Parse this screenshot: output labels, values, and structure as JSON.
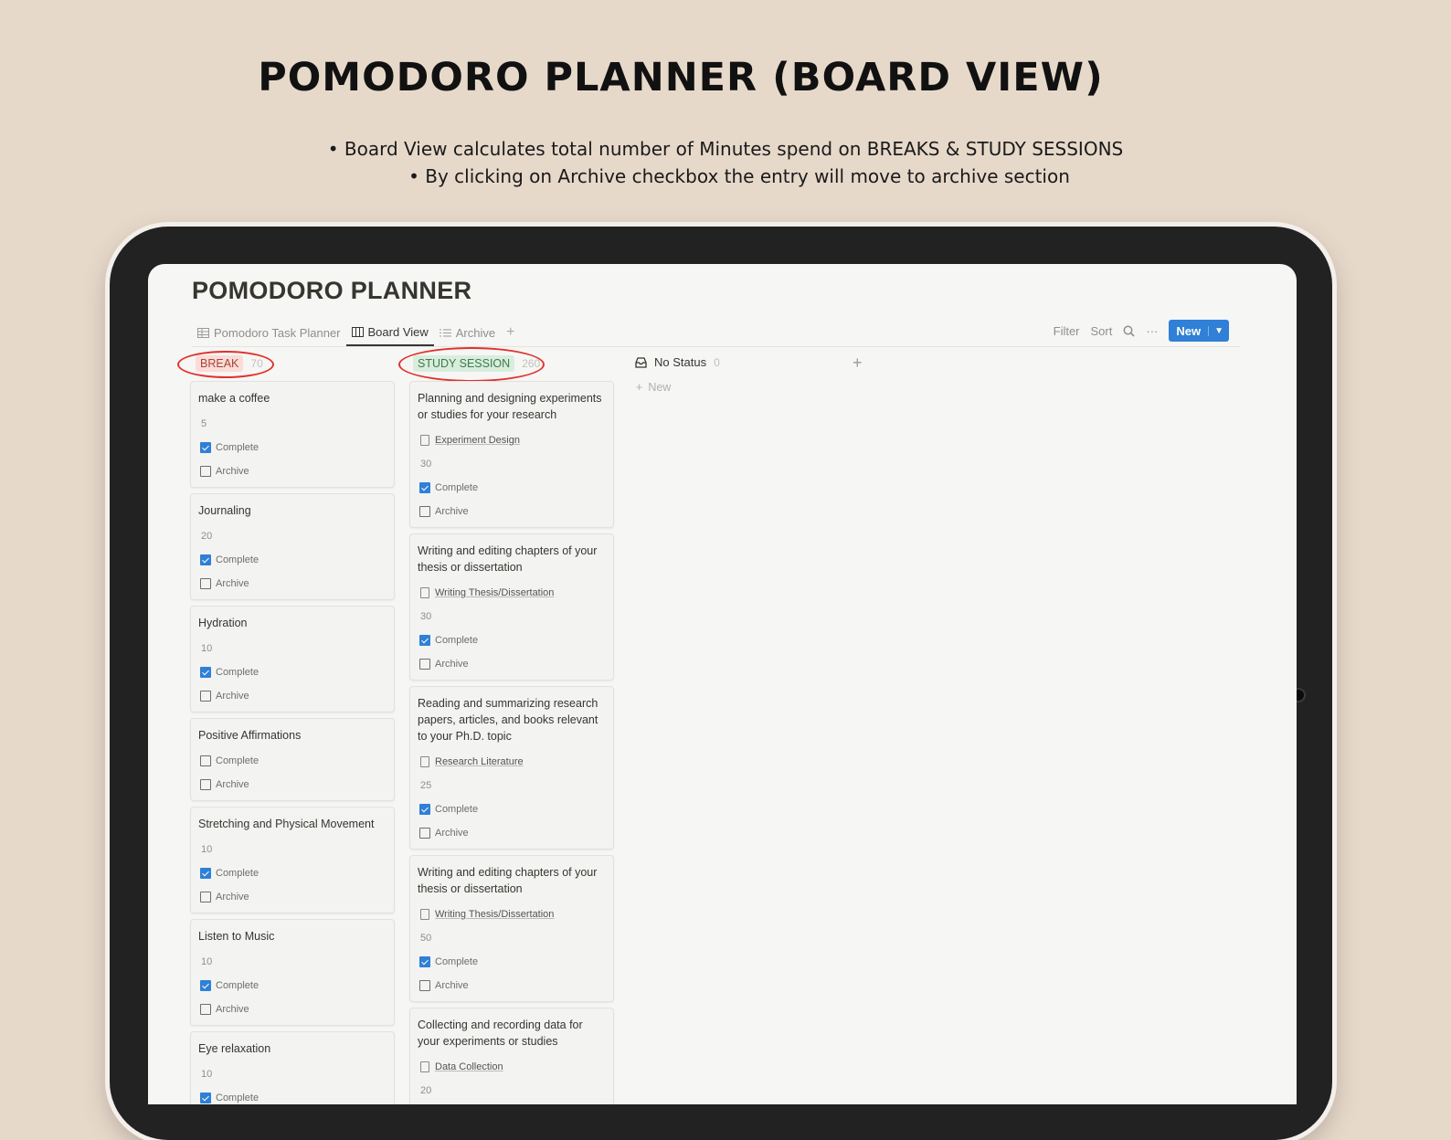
{
  "headline": "POMODORO PLANNER (BOARD VIEW)",
  "bullets": [
    "Board View calculates total number of Minutes spend on BREAKS & STUDY SESSIONS",
    "By clicking on Archive checkbox the entry will move to archive section"
  ],
  "app": {
    "page_title": "POMODORO PLANNER",
    "tabs": [
      {
        "label": "Pomodoro Task Planner",
        "icon": "table-icon",
        "active": false
      },
      {
        "label": "Board View",
        "icon": "board-icon",
        "active": true
      },
      {
        "label": "Archive",
        "icon": "list-icon",
        "active": false
      }
    ],
    "toolbar": {
      "filter": "Filter",
      "sort": "Sort",
      "more": "···",
      "new": "New"
    },
    "columns": [
      {
        "name": "BREAK",
        "count": "70",
        "color": "#fbdcd7"
      },
      {
        "name": "STUDY SESSION",
        "count": "260",
        "color": "#d9eddc"
      },
      {
        "name": "No Status",
        "count": "0"
      }
    ],
    "new_label": "New",
    "prop_labels": {
      "complete": "Complete",
      "archive": "Archive"
    },
    "break_cards": [
      {
        "title": "make a coffee",
        "minutes": "5",
        "complete": true,
        "archive": false
      },
      {
        "title": "Journaling",
        "minutes": "20",
        "complete": true,
        "archive": false
      },
      {
        "title": "Hydration",
        "minutes": "10",
        "complete": true,
        "archive": false
      },
      {
        "title": "Positive Affirmations",
        "minutes": "",
        "complete": false,
        "archive": false
      },
      {
        "title": "Stretching and Physical Movement",
        "minutes": "10",
        "complete": true,
        "archive": false
      },
      {
        "title": "Listen to Music",
        "minutes": "10",
        "complete": true,
        "archive": false
      },
      {
        "title": "Eye relaxation",
        "minutes": "10",
        "complete": true,
        "archive": false
      }
    ],
    "study_cards": [
      {
        "title": "Planning and designing experiments or studies for your research",
        "relation": "Experiment Design",
        "minutes": "30",
        "complete": true,
        "archive": false
      },
      {
        "title": "Writing and editing chapters of your thesis or dissertation",
        "relation": "Writing Thesis/Dissertation",
        "minutes": "30",
        "complete": true,
        "archive": false
      },
      {
        "title": "Reading and summarizing research papers, articles, and books relevant to your Ph.D. topic",
        "relation": "Research Literature",
        "minutes": "25",
        "complete": true,
        "archive": false
      },
      {
        "title": "Writing and editing chapters of your thesis or dissertation",
        "relation": "Writing Thesis/Dissertation",
        "minutes": "50",
        "complete": true,
        "archive": false
      },
      {
        "title": "Collecting and recording data for your experiments or studies",
        "relation": "Data Collection",
        "minutes": "20",
        "complete": true,
        "archive": false
      }
    ]
  }
}
